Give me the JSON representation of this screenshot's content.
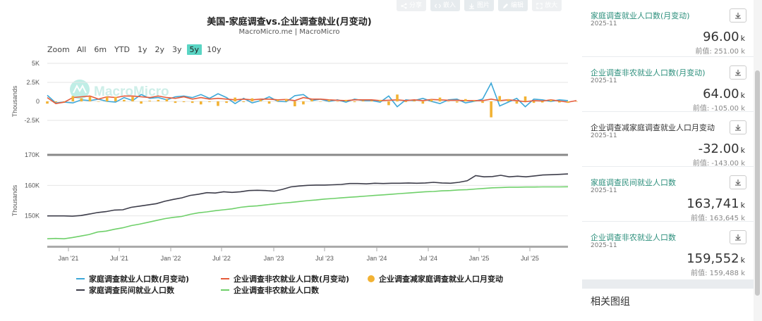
{
  "toolbar": {
    "buttons": [
      {
        "name": "share",
        "label": "分享"
      },
      {
        "name": "embed",
        "label": "嵌入"
      },
      {
        "name": "image",
        "label": "图片"
      },
      {
        "name": "edit",
        "label": "编辑"
      },
      {
        "name": "fullscreen",
        "label": "放大"
      }
    ]
  },
  "header": {
    "title": "美国-家庭调查vs.企业调查就业(月变动)",
    "subtitle": "MacroMicro.me | MacroMicro",
    "watermark": "MacroMicro"
  },
  "zoom": {
    "label": "Zoom",
    "options": [
      "All",
      "6m",
      "YTD",
      "1y",
      "2y",
      "3y",
      "5y",
      "10y"
    ],
    "active": "5y"
  },
  "chart_data": [
    {
      "type": "line",
      "ylabel": "Thousands",
      "ylim": [
        -5000,
        5000
      ],
      "yticks": [
        "5K",
        "2.5K",
        "0",
        "-2.5K"
      ],
      "ytick_values": [
        5000,
        2500,
        0,
        -2500
      ],
      "xlim": [
        0,
        58
      ],
      "series": [
        {
          "name": "家庭调查就业人口数(月变动)",
          "color": "#3da8d8",
          "kind": "line",
          "values": [
            800,
            -200,
            -100,
            -200,
            200,
            100,
            300,
            0,
            -100,
            500,
            100,
            900,
            400,
            500,
            200,
            600,
            700,
            500,
            900,
            400,
            1000,
            500,
            -300,
            400,
            -200,
            100,
            600,
            0,
            -50,
            750,
            900,
            100,
            300,
            0,
            200,
            -100,
            300,
            100,
            100,
            -100,
            700,
            -700,
            200,
            100,
            400,
            0,
            -300,
            200,
            300,
            -200,
            0,
            300,
            2400,
            -600,
            -100,
            400,
            -700,
            300,
            200,
            0,
            200,
            100
          ]
        },
        {
          "name": "企业调查非农就业人口数(月变动)",
          "color": "#e55a3a",
          "kind": "line",
          "values": [
            500,
            -300,
            -100,
            500,
            600,
            700,
            300,
            600,
            500,
            700,
            700,
            600,
            500,
            700,
            500,
            400,
            600,
            300,
            500,
            300,
            400,
            300,
            200,
            300,
            200,
            300,
            300,
            200,
            250,
            100,
            500,
            300,
            300,
            200,
            150,
            100,
            200,
            200,
            200,
            100,
            150,
            200,
            100,
            200,
            100,
            250,
            200,
            150,
            150,
            100,
            100,
            100,
            300,
            100,
            200,
            100,
            -50,
            100,
            50,
            200,
            50,
            -100,
            100
          ]
        },
        {
          "name": "企业调查减家庭调查就业人口月变动",
          "color": "#f2b233",
          "kind": "bar",
          "values": [
            -300,
            -100,
            0,
            700,
            400,
            600,
            0,
            600,
            600,
            200,
            600,
            -300,
            100,
            200,
            300,
            -200,
            -100,
            -200,
            -400,
            -100,
            -600,
            -200,
            500,
            -100,
            400,
            200,
            -300,
            200,
            300,
            -650,
            -400,
            200,
            0,
            200,
            -50,
            200,
            -100,
            100,
            100,
            200,
            -500,
            900,
            -100,
            100,
            -300,
            250,
            500,
            -50,
            -150,
            300,
            100,
            -200,
            -2100,
            700,
            300,
            -300,
            650,
            -200,
            -150,
            200,
            -150,
            -200,
            0
          ]
        }
      ],
      "x_categories": [
        "Jan '21",
        "Jul '21",
        "Jan '22",
        "Jul '22",
        "Jan '23",
        "Jul '23",
        "Jan '24",
        "Jul '24",
        "Jan '25",
        "Jul '25"
      ]
    },
    {
      "type": "line",
      "ylabel": "Thousands",
      "ylim": [
        140000,
        170000
      ],
      "yticks": [
        "170K",
        "160K",
        "150K"
      ],
      "ytick_values": [
        170000,
        160000,
        150000
      ],
      "xlim": [
        0,
        58
      ],
      "series": [
        {
          "name": "家庭调查民间就业人口数",
          "color": "#3d3d4a",
          "kind": "line",
          "values": [
            150000,
            150000,
            150000,
            149900,
            150100,
            150600,
            151100,
            151400,
            151900,
            152000,
            152800,
            153200,
            153600,
            154000,
            154800,
            155400,
            155900,
            156700,
            157100,
            157600,
            157500,
            157900,
            157700,
            157900,
            158300,
            158400,
            158300,
            158100,
            158700,
            159500,
            159800,
            160000,
            160100,
            160100,
            160200,
            160300,
            160600,
            160600,
            160500,
            160700,
            160600,
            160700,
            160700,
            160800,
            160700,
            160800,
            161000,
            160800,
            160700,
            161000,
            161500,
            163200,
            162800,
            162900,
            163300,
            162800,
            163000,
            162800,
            163100,
            163400,
            163500,
            163600,
            163741
          ]
        },
        {
          "name": "企业调查非农就业人口数",
          "color": "#6fd06a",
          "kind": "line",
          "values": [
            142500,
            142600,
            142500,
            142900,
            143400,
            143900,
            144700,
            145000,
            145600,
            146100,
            146800,
            147300,
            147900,
            148500,
            149100,
            149500,
            149800,
            150500,
            151000,
            151300,
            151700,
            152000,
            152300,
            152800,
            153100,
            153300,
            153600,
            153900,
            154200,
            154400,
            154700,
            155000,
            155200,
            155500,
            155700,
            155900,
            156100,
            156300,
            156500,
            156700,
            156900,
            157100,
            157300,
            157500,
            157700,
            157900,
            158000,
            158200,
            158300,
            158500,
            158600,
            158800,
            159000,
            159200,
            159300,
            159400,
            159400,
            159450,
            159450,
            159500,
            159500,
            159500,
            159552
          ]
        }
      ],
      "x_categories": [
        "Jan '21",
        "Jul '21",
        "Jan '22",
        "Jul '22",
        "Jan '23",
        "Jul '23",
        "Jan '24",
        "Jul '24",
        "Jan '25",
        "Jul '25"
      ]
    }
  ],
  "legend": [
    {
      "label": "家庭调查就业人口数(月变动)",
      "color": "#3da8d8",
      "kind": "line"
    },
    {
      "label": "企业调查非农就业人口数(月变动)",
      "color": "#e55a3a",
      "kind": "line"
    },
    {
      "label": "企业调查减家庭调查就业人口月变动",
      "color": "#f2b233",
      "kind": "dot"
    },
    {
      "label": "家庭调查民间就业人口数",
      "color": "#3d3d4a",
      "kind": "line"
    },
    {
      "label": "企业调查非农就业人口数",
      "color": "#6fd06a",
      "kind": "line"
    }
  ],
  "side_cards": [
    {
      "title": "家庭调查就业人口数(月变动)",
      "date": "2025-11",
      "value": "96.00",
      "unit": "k",
      "prev": "前值: 251.00 k",
      "dark": false
    },
    {
      "title": "企业调查非农就业人口数(月变动)",
      "date": "2025-11",
      "value": "64.00",
      "unit": "k",
      "prev": "前值: -105.00 k",
      "dark": false
    },
    {
      "title": "企业调查减家庭调查就业人口月变动",
      "date": "2025-11",
      "value": "-32.00",
      "unit": "k",
      "prev": "前值: -143.00 k",
      "dark": true
    },
    {
      "title": "家庭调查民间就业人口数",
      "date": "2025-11",
      "value": "163,741",
      "unit": "k",
      "prev": "前值: 163,645 k",
      "dark": false
    },
    {
      "title": "企业调查非农就业人口数",
      "date": "2025-11",
      "value": "159,552",
      "unit": "k",
      "prev": "前值: 159,488 k",
      "dark": false
    }
  ],
  "related": {
    "title": "相关图组"
  }
}
